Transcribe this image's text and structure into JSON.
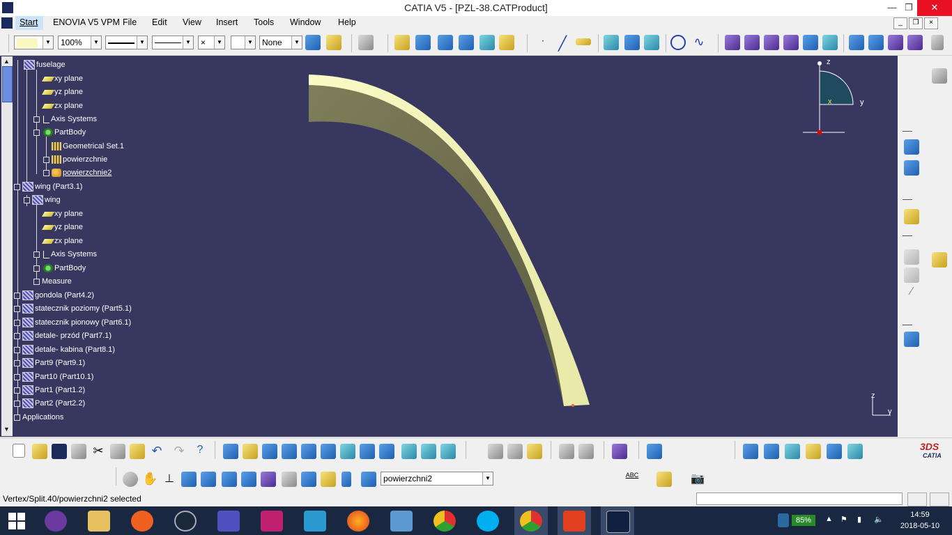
{
  "window": {
    "title": "CATIA V5 - [PZL-38.CATProduct]",
    "minimize_label": "—",
    "restore_label": "❐",
    "close_label": "✕"
  },
  "menu": {
    "items": [
      "Start",
      "ENOVIA V5 VPM",
      "File",
      "Edit",
      "View",
      "Insert",
      "Tools",
      "Window",
      "Help"
    ]
  },
  "toolbar_top": {
    "color_value": "",
    "zoom_value": "100%",
    "linetype_value": "",
    "thickness_value": "",
    "point_value": "×",
    "layer_value": "",
    "none_value": "None"
  },
  "tree": {
    "items": [
      "fuselage",
      "xy plane",
      "yz plane",
      "zx plane",
      "Axis Systems",
      "PartBody",
      "Geometrical Set.1",
      "powierzchnie",
      "powierzchnie2",
      "wing (Part3.1)",
      "wing",
      "xy plane",
      "yz plane",
      "zx plane",
      "Axis Systems",
      "PartBody",
      "Measure",
      "gondola (Part4.2)",
      "statecznik poziomy (Part5.1)",
      "statecznik pionowy (Part6.1)",
      "detale- przód (Part7.1)",
      "detale- kabina (Part8.1)",
      "Part9 (Part9.1)",
      "Part10 (Part10.1)",
      "Part1 (Part1.2)",
      "Part2 (Part2.2)",
      "Applications"
    ]
  },
  "compass": {
    "z": "z",
    "x": "x",
    "y": "y"
  },
  "axis_triad": {
    "z": "z",
    "y": "y"
  },
  "toolbar_bottom": {
    "current_selection": "powierzchni2",
    "abc_label": "ABC"
  },
  "catia_logo": "CATIA",
  "status": {
    "message": "Vertex/Split.40/powierzchni2 selected",
    "command_input": ""
  },
  "taskbar": {
    "battery": "85%",
    "time": "14:59",
    "date": "2018-05-10"
  }
}
